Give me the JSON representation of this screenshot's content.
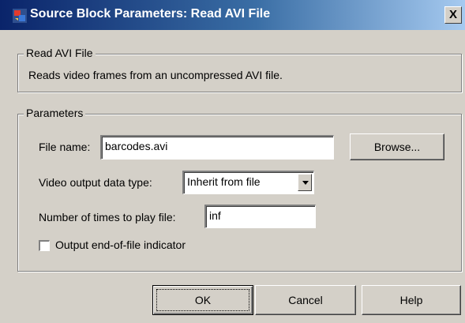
{
  "window": {
    "title": "Source Block Parameters: Read AVI File",
    "close_label": "X"
  },
  "description_group": {
    "legend": "Read AVI File",
    "text": "Reads video frames from an uncompressed AVI file."
  },
  "parameters_group": {
    "legend": "Parameters",
    "file_name_label": "File name:",
    "file_name_value": "barcodes.avi",
    "browse_label": "Browse...",
    "video_type_label": "Video output data type:",
    "video_type_value": "Inherit from file",
    "play_times_label": "Number of times to play file:",
    "play_times_value": "inf",
    "eof_label": "Output end-of-file indicator",
    "eof_checked": false
  },
  "buttons": {
    "ok": "OK",
    "cancel": "Cancel",
    "help": "Help"
  },
  "icons": {
    "app": "simulink-block-icon",
    "close": "close-icon",
    "dropdown": "chevron-down-icon"
  }
}
